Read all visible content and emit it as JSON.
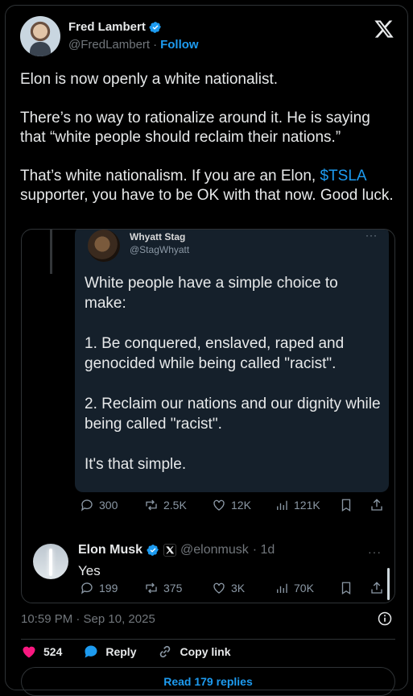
{
  "author": {
    "name": "Fred Lambert",
    "handle": "@FredLambert",
    "separator": "·",
    "follow_label": "Follow"
  },
  "tweet": {
    "paragraphs": [
      "Elon is now openly a white nationalist.",
      "There’s no way to rationalize around it. He is saying that “white people should reclaim their nations.”"
    ],
    "last_para_before": "That’s white nationalism. If you are an Elon, ",
    "cashtag": "$TSLA",
    "last_para_after": " supporter, you have to be OK with that now. Good luck."
  },
  "quoted": {
    "name": "Whyatt Stag",
    "handle": "@StagWhyatt",
    "more": "···",
    "paragraphs": [
      "White people have a simple choice to make:",
      "1. Be conquered, enslaved, raped and genocided while being called \"racist\".",
      "2. Reclaim our nations and our dignity while being called \"racist\".",
      "It's that simple."
    ],
    "stats": {
      "replies": "300",
      "reposts": "2.5K",
      "likes": "12K",
      "views": "121K"
    }
  },
  "reply": {
    "name": "Elon Musk",
    "handle": "@elonmusk",
    "time": "· 1d",
    "more": "···",
    "text": "Yes",
    "stats": {
      "replies": "199",
      "reposts": "375",
      "likes": "3K",
      "views": "70K"
    }
  },
  "timestamp": "10:59 PM · Sep 10, 2025",
  "actions": {
    "like_count": "524",
    "reply_label": "Reply",
    "copy_label": "Copy link"
  },
  "read_replies": "Read 179 replies",
  "colors": {
    "accent": "#1d9bf0",
    "like": "#f91880",
    "background": "#000000",
    "quoted_bg": "#15202b"
  },
  "icons": [
    "x-logo-icon",
    "verified-badge-icon",
    "reply-icon",
    "repost-icon",
    "heart-icon",
    "views-icon",
    "bookmark-icon",
    "share-icon",
    "info-icon",
    "link-icon"
  ]
}
